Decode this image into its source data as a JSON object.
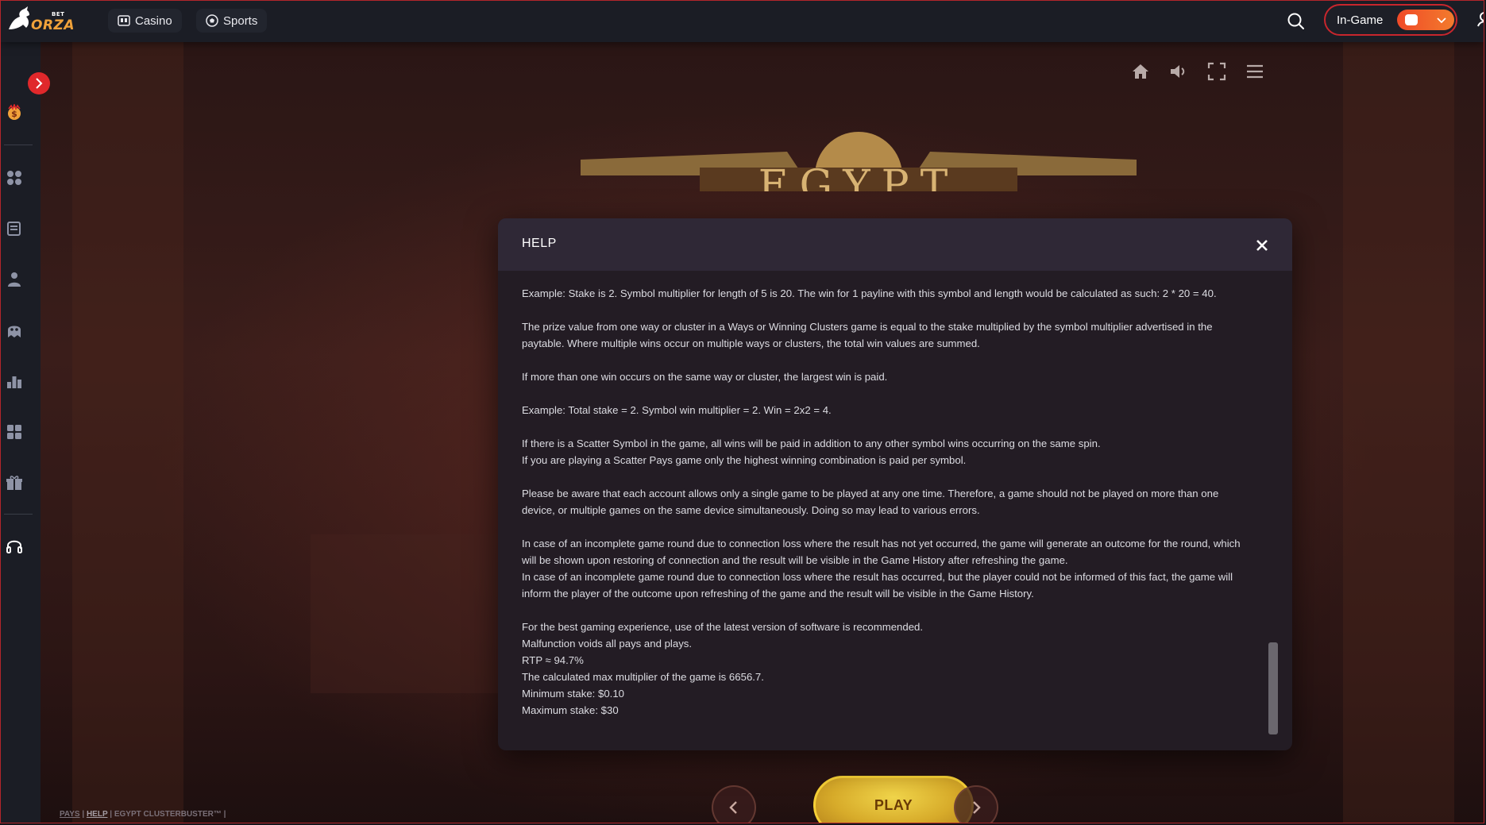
{
  "brand": {
    "bet": "BET",
    "name": "ORZA"
  },
  "topnav": {
    "items": [
      {
        "label": "Casino",
        "icon": "casino-icon"
      },
      {
        "label": "Sports",
        "icon": "soccer-ball-icon"
      }
    ],
    "in_game_label": "In-Game",
    "in_game_toggle": "on"
  },
  "sidebar": {
    "icons": [
      "bonus-coin-icon",
      "grid-icon",
      "news-icon",
      "person-icon",
      "ghost-icon",
      "leaderboard-icon",
      "apps-icon",
      "gift-icon",
      "support-headset-icon"
    ]
  },
  "game": {
    "title_banner": "EGYPT",
    "toolbar": [
      "home-icon",
      "sound-icon",
      "fullscreen-icon",
      "menu-icon"
    ]
  },
  "help": {
    "title": "HELP",
    "paragraphs": [
      "Example: Stake is 2. Symbol multiplier for length of 5 is 20. The win for 1 payline with this symbol and length would be calculated as such: 2 * 20 = 40.",
      "The prize value from one way or cluster in a Ways or Winning Clusters game is equal to the stake multiplied by the symbol multiplier advertised in the paytable. Where multiple wins occur on multiple ways or clusters, the total win values are summed.",
      "If more than one win occurs on the same way or cluster, the largest win is paid.",
      "Example: Total stake = 2. Symbol win multiplier = 2. Win = 2x2 = 4.",
      "If there is a Scatter Symbol in the game, all wins will be paid in addition to any other symbol wins occurring on the same spin.\nIf you are playing a Scatter Pays game only the highest winning combination is paid per symbol.",
      "Please be aware that each account allows only a single game to be played at any one time. Therefore, a game should not be played on more than one device, or multiple games on the same device simultaneously. Doing so may lead to various errors.",
      "In case of an incomplete game round due to connection loss where the result has not yet occurred, the game will generate an outcome for the round, which will be shown upon restoring of connection and the result will be visible in the Game History after refreshing the game.\nIn case of an incomplete game round due to connection loss where the result has occurred, but the player could not be informed of this fact, the game will inform the player of the outcome upon refreshing of the game and the result will be visible in the Game History."
    ],
    "final_lines": [
      "For the best gaming experience, use of the latest version of software is recommended.",
      "Malfunction voids all pays and plays.",
      "RTP ≈ 94.7%",
      "The calculated max multiplier of the game is 6656.7.",
      "Minimum stake: $0.10",
      "Maximum stake: $30"
    ]
  },
  "controls": {
    "play_label": "PLAY"
  },
  "footer": {
    "pays": "PAYS",
    "help": "HELP",
    "game_name": "EGYPT CLUSTERBUSTER™"
  },
  "colors": {
    "accent": "#e0282b",
    "brand_orange": "#f0a23a",
    "play_gold": "#f5cf36"
  }
}
